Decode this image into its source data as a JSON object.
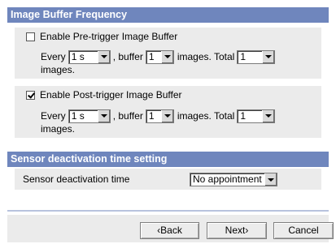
{
  "sections": {
    "buffer_title": "Image Buffer Frequency",
    "sensor_title": "Sensor deactivation time setting"
  },
  "pre": {
    "label": "Enable Pre-trigger Image Buffer",
    "checked": false,
    "every": "Every",
    "interval": "1 s",
    "buffer_text": ", buffer",
    "buffer": "1",
    "images_total": "images. Total",
    "total": "1",
    "images_end": "images."
  },
  "post": {
    "label": "Enable Post-trigger Image Buffer",
    "checked": true,
    "every": "Every",
    "interval": "1 s",
    "buffer_text": ", buffer",
    "buffer": "1",
    "images_total": "images. Total",
    "total": "1",
    "images_end": "images."
  },
  "sensor": {
    "label": "Sensor deactivation time",
    "value": "No appointment"
  },
  "buttons": {
    "back": "‹Back",
    "next": "Next›",
    "cancel": "Cancel"
  },
  "colors": {
    "header": "#6f86bd",
    "panel": "#ebebeb",
    "divider": "#b8c3de"
  },
  "icons": {
    "dropdown": "chevron-down-icon",
    "checkbox": "checkbox"
  }
}
